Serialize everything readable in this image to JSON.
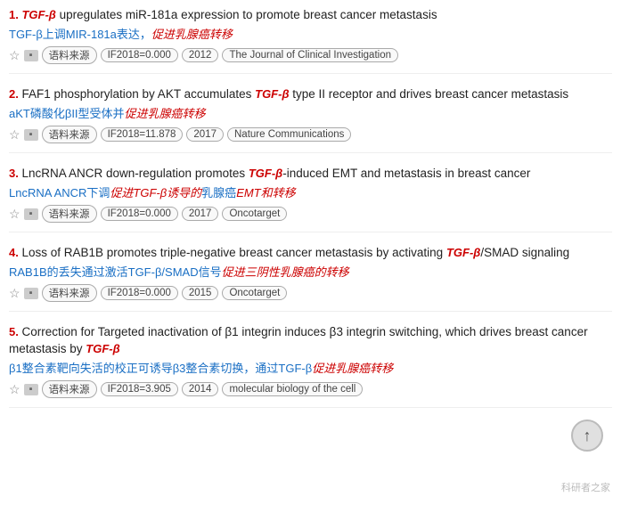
{
  "results": [
    {
      "number": "1.",
      "title_parts": [
        {
          "text": "TGF-β",
          "italic_red": true
        },
        {
          "text": " upregulates miR-181a expression to promote breast cancer metastasis",
          "italic_red": false
        }
      ],
      "chinese_title_parts": [
        {
          "text": "TGF-β上调MIR-181a表达，",
          "italic_red": false
        },
        {
          "text": "促进乳腺癌转移",
          "italic_red": true
        }
      ],
      "year": "2012",
      "if": "IF2018=0.000",
      "journal": "The Journal of Clinical Investigation",
      "source_label": "语料来源"
    },
    {
      "number": "2.",
      "title_parts": [
        {
          "text": "FAF1 phosphorylation by AKT accumulates ",
          "italic_red": false
        },
        {
          "text": "TGF-β",
          "italic_red": true
        },
        {
          "text": " type II receptor and drives breast cancer metastasis",
          "italic_red": false
        }
      ],
      "chinese_title_parts": [
        {
          "text": "aKT磷酸化βII型受体并",
          "italic_red": false
        },
        {
          "text": "促进乳腺癌转移",
          "italic_red": true
        }
      ],
      "year": "2017",
      "if": "IF2018=11.878",
      "journal": "Nature Communications",
      "source_label": "语料来源"
    },
    {
      "number": "3.",
      "title_parts": [
        {
          "text": "LncRNA ANCR down-regulation promotes ",
          "italic_red": false
        },
        {
          "text": "TGF-β",
          "italic_red": true
        },
        {
          "text": "-induced EMT and metastasis in breast cancer",
          "italic_red": false
        }
      ],
      "chinese_title_parts": [
        {
          "text": "LncRNA ANCR下调",
          "italic_red": false
        },
        {
          "text": "促进TGF-β诱导的",
          "italic_red": true
        },
        {
          "text": "乳腺癌",
          "italic_red": false
        },
        {
          "text": "EMT和转移",
          "italic_red": true
        }
      ],
      "year": "2017",
      "if": "IF2018=0.000",
      "journal": "Oncotarget",
      "source_label": "语料来源"
    },
    {
      "number": "4.",
      "title_parts": [
        {
          "text": "Loss of RAB1B promotes triple-negative breast cancer metastasis by activating ",
          "italic_red": false
        },
        {
          "text": "TGF-β",
          "italic_red": true
        },
        {
          "text": "/SMAD signaling",
          "italic_red": false
        }
      ],
      "chinese_title_parts": [
        {
          "text": "RAB1B的丢失通过激活TGF-β/SMAD信号",
          "italic_red": false
        },
        {
          "text": "促进三阴性乳腺癌的转移",
          "italic_red": true
        }
      ],
      "year": "2015",
      "if": "IF2018=0.000",
      "journal": "Oncotarget",
      "source_label": "语料来源"
    },
    {
      "number": "5.",
      "title_parts": [
        {
          "text": "Correction for Targeted inactivation of β1 integrin induces β3 integrin switching, which drives breast cancer metastasis by ",
          "italic_red": false
        },
        {
          "text": "TGF-β",
          "italic_red": true
        }
      ],
      "chinese_title_parts": [
        {
          "text": "β1整合素靶向失活的校正可诱导β3整合素切换，通过TGF-β",
          "italic_red": false
        },
        {
          "text": "促进乳腺癌转移",
          "italic_red": true
        }
      ],
      "year": "2014",
      "if": "IF2018=3.905",
      "journal": "molecular biology of the cell",
      "source_label": "语料来源"
    }
  ],
  "up_button_label": "↑",
  "watermark": "科研者之家"
}
